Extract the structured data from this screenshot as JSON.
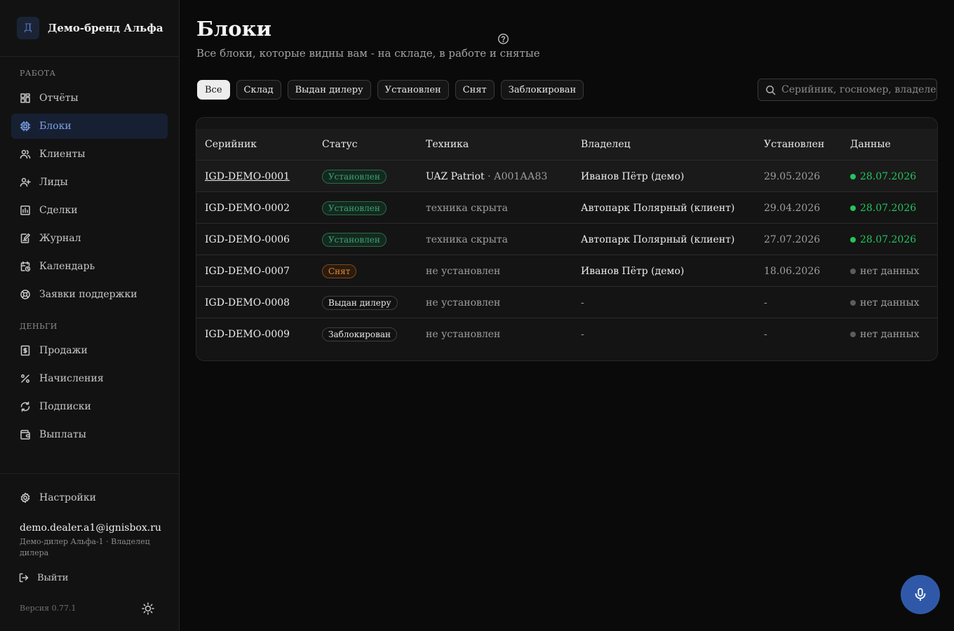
{
  "sidebar": {
    "brand": {
      "logo_letter": "Д",
      "name": "Демо-бренд Альфа"
    },
    "sections": {
      "work": "РАБОТА",
      "money": "ДЕНЬГИ"
    },
    "items": [
      {
        "label": "Отчёты",
        "icon": "reports-grid-icon"
      },
      {
        "label": "Блоки",
        "icon": "chip-icon",
        "active": true
      },
      {
        "label": "Клиенты",
        "icon": "users-icon"
      },
      {
        "label": "Лиды",
        "icon": "user-plus-icon"
      },
      {
        "label": "Сделки",
        "icon": "deals-chart-icon"
      },
      {
        "label": "Журнал",
        "icon": "journal-edit-icon"
      },
      {
        "label": "Календарь",
        "icon": "calendar-clock-icon"
      },
      {
        "label": "Заявки поддержки",
        "icon": "lifebuoy-icon"
      },
      {
        "label": "Продажи",
        "icon": "dollar-receipt-icon"
      },
      {
        "label": "Начисления",
        "icon": "percent-icon"
      },
      {
        "label": "Подписки",
        "icon": "refresh-icon"
      },
      {
        "label": "Выплаты",
        "icon": "wallet-icon"
      },
      {
        "label": "Настройки",
        "icon": "gear-icon"
      }
    ],
    "user": {
      "email": "demo.dealer.a1@ignisbox.ru",
      "role": "Демо-дилер Альфа-1 · Владелец дилера"
    },
    "logout_label": "Выйти",
    "version": "Версия 0.77.1"
  },
  "page": {
    "title": "Блоки",
    "subtitle": "Все блоки, которые видны вам - на складе, в работе и снятые"
  },
  "filters": [
    "Все",
    "Склад",
    "Выдан дилеру",
    "Установлен",
    "Снят",
    "Заблокирован"
  ],
  "filters_active": "Все",
  "search": {
    "placeholder": "Серийник, госномер, владелец",
    "value": ""
  },
  "table": {
    "columns": [
      "Серийник",
      "Статус",
      "Техника",
      "Владелец",
      "Установлен",
      "Данные"
    ],
    "rows": [
      {
        "serial": "IGD-DEMO-0001",
        "status": "Установлен",
        "vehicle": "UAZ Patriot",
        "plate": "· А001АА83",
        "owner": "Иванов Пётр (демо)",
        "installed": "29.05.2026",
        "data": "28.07.2026",
        "data_ok": true
      },
      {
        "serial": "IGD-DEMO-0002",
        "status": "Установлен",
        "vehicle": "техника скрыта",
        "plate": "",
        "owner": "Автопарк Полярный (клиент)",
        "installed": "29.04.2026",
        "data": "28.07.2026",
        "data_ok": true
      },
      {
        "serial": "IGD-DEMO-0006",
        "status": "Установлен",
        "vehicle": "техника скрыта",
        "plate": "",
        "owner": "Автопарк Полярный (клиент)",
        "installed": "27.07.2026",
        "data": "28.07.2026",
        "data_ok": true
      },
      {
        "serial": "IGD-DEMO-0007",
        "status": "Снят",
        "vehicle": "не установлен",
        "plate": "",
        "owner": "Иванов Пётр (демо)",
        "installed": "18.06.2026",
        "data": "нет данных",
        "data_ok": false
      },
      {
        "serial": "IGD-DEMO-0008",
        "status": "Выдан дилеру",
        "vehicle": "не установлен",
        "plate": "",
        "owner": "-",
        "installed": "-",
        "data": "нет данных",
        "data_ok": false
      },
      {
        "serial": "IGD-DEMO-0009",
        "status": "Заблокирован",
        "vehicle": "не установлен",
        "plate": "",
        "owner": "-",
        "installed": "-",
        "data": "нет данных",
        "data_ok": false
      }
    ]
  },
  "colors": {
    "accent": "#7ea2e6",
    "status_installed": "#3ea36f",
    "status_removed": "#e08a3a",
    "data_ok": "#22c55e",
    "mic_button": "#2f59a8"
  }
}
